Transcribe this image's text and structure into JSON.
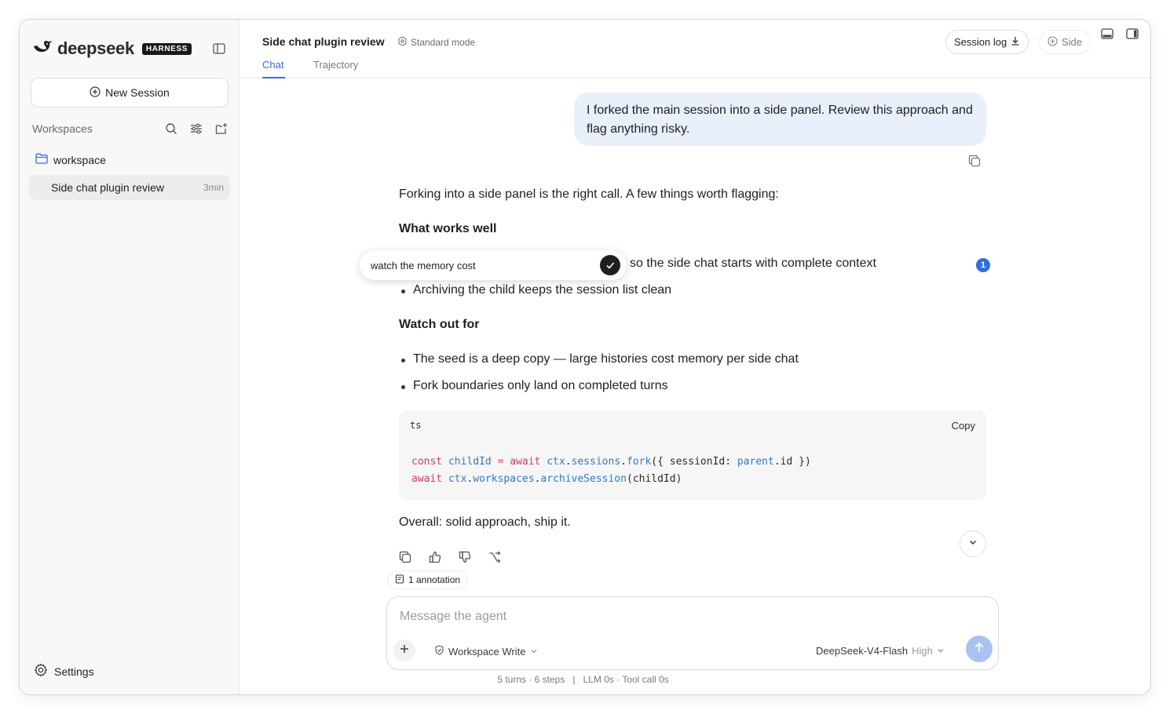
{
  "sidebar": {
    "logo_text": "deepseek",
    "logo_badge": "HARNESS",
    "new_session_label": "New Session",
    "workspaces_label": "Workspaces",
    "folder_name": "workspace",
    "sessions": [
      {
        "title": "Side chat plugin review",
        "time": "3min"
      }
    ],
    "settings_label": "Settings"
  },
  "header": {
    "title": "Side chat plugin review",
    "mode": "Standard mode",
    "tabs": [
      {
        "label": "Chat",
        "active": true
      },
      {
        "label": "Trajectory",
        "active": false
      }
    ],
    "session_log_label": "Session log",
    "side_label": "Side"
  },
  "chat": {
    "user_message": "I forked the main session into a side panel. Review this approach and flag anything risky.",
    "intro": "Forking into a side panel is the right call. A few things worth flagging:",
    "section1_heading": "What works well",
    "section1_items": [
      "so the side chat starts with complete context",
      "Archiving the child keeps the session list clean"
    ],
    "section2_heading": "Watch out for",
    "section2_items": [
      "The seed is a deep copy — large histories cost memory per side chat",
      "Fork boundaries only land on completed turns"
    ],
    "code": {
      "lang": "ts",
      "copy_label": "Copy"
    },
    "closing": "Overall: solid approach, ship it.",
    "annotation_popover_text": "watch the memory cost",
    "annotation_badge": "1",
    "annotation_count_label": "1 annotation"
  },
  "composer": {
    "placeholder": "Message the agent",
    "workspace_mode": "Workspace Write",
    "model": "DeepSeek-V4-Flash",
    "effort": "High"
  },
  "footer": {
    "turns_steps": "5 turns · 6 steps",
    "separator": "|",
    "timing": "LLM 0s · Tool call 0s"
  },
  "colors": {
    "accent": "#2f6fe0",
    "user_bubble": "#e9effb",
    "send_disabled": "#a9c2f2"
  }
}
